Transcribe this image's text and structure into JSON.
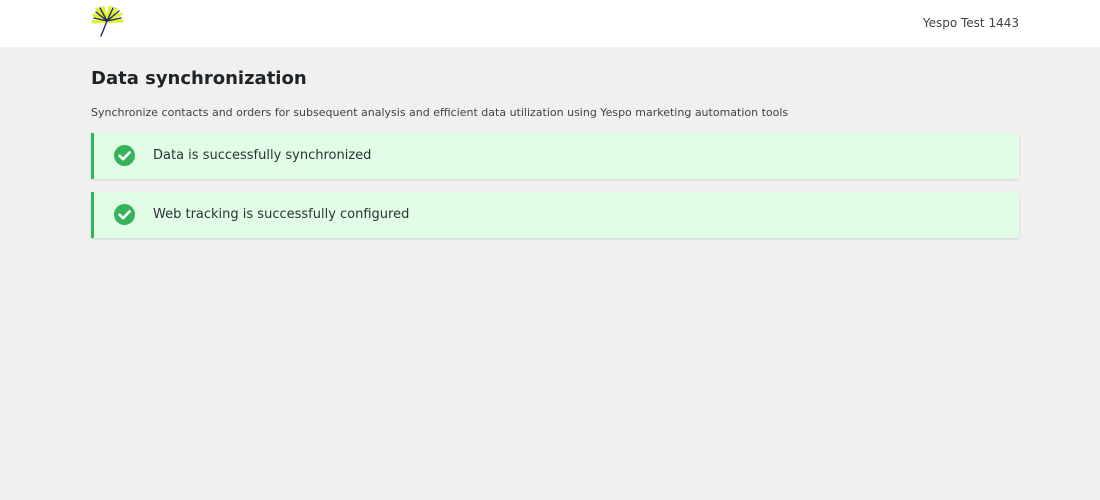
{
  "header": {
    "logo_icon": "yespo-sun-logo-icon",
    "account_name": "Yespo Test 1443"
  },
  "main": {
    "title": "Data synchronization",
    "description": "Synchronize contacts and orders for subsequent analysis and efficient data utilization using Yespo marketing automation tools",
    "notices": [
      {
        "icon": "check-circle-icon",
        "text": "Data is successfully synchronized",
        "status": "success"
      },
      {
        "icon": "check-circle-icon",
        "text": "Web tracking is successfully configured",
        "status": "success"
      }
    ]
  },
  "colors": {
    "success_accent": "#34b35a",
    "success_background": "#e2fde6",
    "logo_yellow": "#e4f224",
    "logo_navy": "#1c2a6b"
  }
}
